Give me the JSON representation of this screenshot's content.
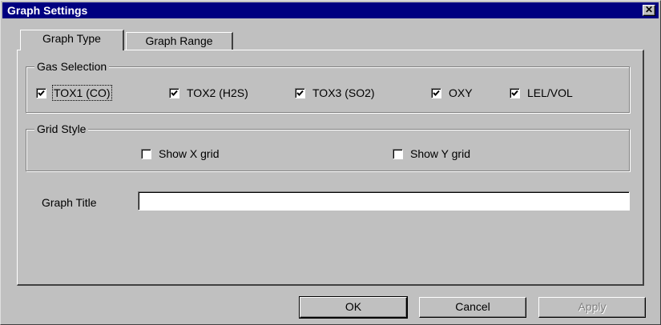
{
  "window": {
    "title": "Graph Settings",
    "close_label": "✕"
  },
  "tabs": [
    {
      "label": "Graph Type",
      "active": true
    },
    {
      "label": "Graph Range",
      "active": false
    }
  ],
  "gas_selection": {
    "legend": "Gas Selection",
    "items": [
      {
        "label": "TOX1 (CO)",
        "checked": true
      },
      {
        "label": "TOX2 (H2S)",
        "checked": true
      },
      {
        "label": "TOX3 (SO2)",
        "checked": true
      },
      {
        "label": "OXY",
        "checked": true
      },
      {
        "label": "LEL/VOL",
        "checked": true
      }
    ]
  },
  "grid_style": {
    "legend": "Grid Style",
    "show_x": {
      "label": "Show X grid",
      "checked": false
    },
    "show_y": {
      "label": "Show Y grid",
      "checked": false
    }
  },
  "graph_title": {
    "label": "Graph Title",
    "value": ""
  },
  "buttons": {
    "ok": "OK",
    "cancel": "Cancel",
    "apply": "Apply"
  }
}
